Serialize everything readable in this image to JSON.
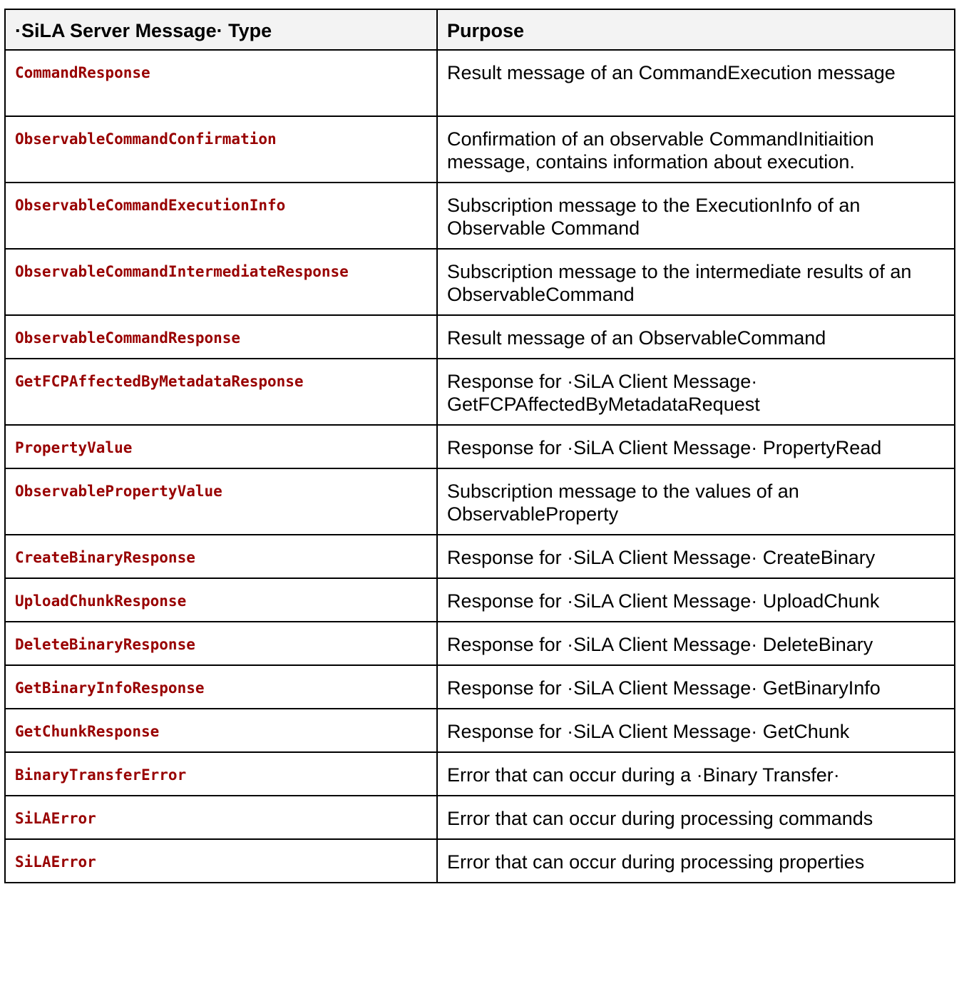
{
  "table": {
    "headers": {
      "type": "·SiLA Server Message· Type",
      "purpose": "Purpose"
    },
    "rows": [
      {
        "type": "CommandResponse",
        "purpose": "Result message of an CommandExecution message"
      },
      {
        "type": "ObservableCommandConfirmation",
        "purpose": "Confirmation of an observable CommandInitiaition message, contains information about execution."
      },
      {
        "type": "ObservableCommandExecutionInfo",
        "purpose": "Subscription message to the ExecutionInfo of an Observable Command"
      },
      {
        "type": "ObservableCommandIntermediateResponse",
        "purpose": "Subscription message to the intermediate results of an ObservableCommand"
      },
      {
        "type": "ObservableCommandResponse",
        "purpose": "Result message of an ObservableCommand"
      },
      {
        "type": "GetFCPAffectedByMetadataResponse",
        "purpose": "Response for ·SiLA Client Message· GetFCPAffectedByMetadataRequest"
      },
      {
        "type": "PropertyValue",
        "purpose": "Response for ·SiLA Client Message· PropertyRead"
      },
      {
        "type": "ObservablePropertyValue",
        "purpose": "Subscription message to the values of an ObservableProperty"
      },
      {
        "type": "CreateBinaryResponse",
        "purpose": "Response for ·SiLA Client Message· CreateBinary"
      },
      {
        "type": "UploadChunkResponse",
        "purpose": "Response for ·SiLA Client Message· UploadChunk"
      },
      {
        "type": "DeleteBinaryResponse",
        "purpose": "Response for ·SiLA Client Message· DeleteBinary"
      },
      {
        "type": "GetBinaryInfoResponse",
        "purpose": "Response for ·SiLA Client Message· GetBinaryInfo"
      },
      {
        "type": "GetChunkResponse",
        "purpose": "Response for ·SiLA Client Message· GetChunk"
      },
      {
        "type": "BinaryTransferError",
        "purpose": "Error that can occur during a ·Binary Transfer·"
      },
      {
        "type": "SiLAError",
        "purpose": "Error that can occur during processing commands"
      },
      {
        "type": "SiLAError",
        "purpose": "Error that can occur during processing properties"
      }
    ]
  }
}
